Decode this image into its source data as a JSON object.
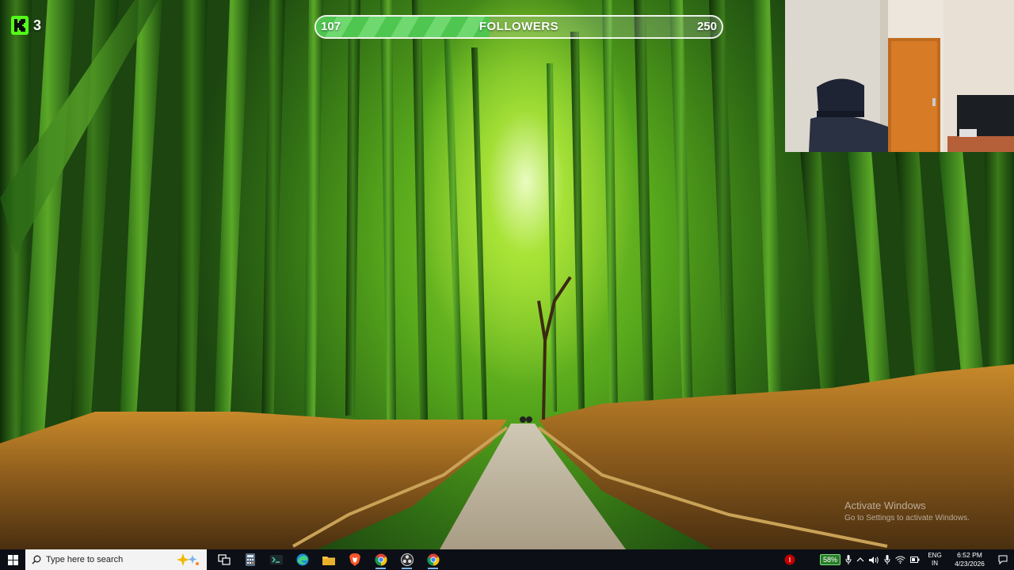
{
  "stream_overlay": {
    "platform_badge": {
      "icon": "kick-logo-icon",
      "count": "3",
      "color": "#53fc18"
    },
    "follower_goal": {
      "current": "107",
      "label": "FOLLOWERS",
      "goal": "250",
      "progress": 0.428,
      "fill_color": "#4fc64f"
    }
  },
  "watermark": {
    "title": "Activate Windows",
    "subtitle": "Go to Settings to activate Windows."
  },
  "taskbar": {
    "start_icon": "windows-start-icon",
    "search": {
      "placeholder": "Type here to search",
      "icon": "search-icon"
    },
    "pinned": [
      {
        "name": "task-view",
        "icon": "task-view-icon"
      },
      {
        "name": "calculator",
        "icon": "calculator-icon"
      },
      {
        "name": "terminal",
        "icon": "terminal-icon"
      },
      {
        "name": "edge",
        "icon": "edge-icon"
      },
      {
        "name": "file-explorer",
        "icon": "folder-icon"
      },
      {
        "name": "brave",
        "icon": "brave-icon"
      },
      {
        "name": "chrome",
        "icon": "chrome-icon"
      },
      {
        "name": "obs",
        "icon": "obs-icon"
      },
      {
        "name": "chrome-2",
        "icon": "chrome-icon"
      }
    ],
    "tray": {
      "record_indicator_color": "#c00000",
      "battery_percent": "58%",
      "language": {
        "line1": "ENG",
        "line2": "IN"
      },
      "time": "6:52 PM",
      "date": "4/23/2026"
    }
  }
}
